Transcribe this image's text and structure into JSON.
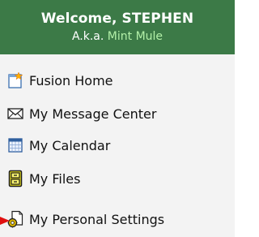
{
  "header": {
    "welcome_text": "Welcome, STEPHEN",
    "aka_prefix": "A.k.a.",
    "alias": "Mint Mule"
  },
  "menu": {
    "items": [
      {
        "label": "Fusion Home",
        "icon": "home-page-icon"
      },
      {
        "label": "My Message Center",
        "icon": "envelope-icon"
      },
      {
        "label": "My Calendar",
        "icon": "calendar-icon"
      },
      {
        "label": "My Files",
        "icon": "file-cabinet-icon"
      },
      {
        "label": "My Personal Settings",
        "icon": "settings-document-icon"
      }
    ]
  },
  "colors": {
    "header_bg": "#3c7a47",
    "alias_text": "#b3f0a8",
    "pointer_arrow": "#e01010"
  }
}
